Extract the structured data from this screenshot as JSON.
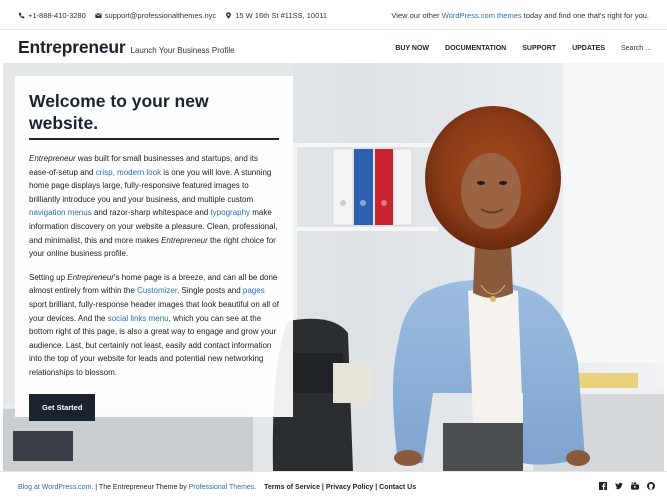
{
  "topbar": {
    "phone": "+1-888-410-3280",
    "email": "support@professionalthemes.nyc",
    "address": "15 W 16th St #11SS, 10011",
    "right_prefix": "View our other",
    "right_link": "WordPress.com themes",
    "right_suffix": "today and find one that's right for you."
  },
  "header": {
    "site_title": "Entrepreneur",
    "tagline": "Launch Your Business Profile",
    "nav": [
      "BUY NOW",
      "DOCUMENTATION",
      "SUPPORT",
      "UPDATES"
    ],
    "search_placeholder": "Search …"
  },
  "welcome": {
    "heading": "Welcome to your new website.",
    "p1": {
      "a": "Entrepreneur",
      "b": " was built for small businesses and startups, and its ease-of-setup and ",
      "link1": "crisp, modern look",
      "c": " is one you will love. A stunning home page displays large, fully-responsive featured images to brilliantly introduce you and your business, and multiple custom ",
      "link2": "navigation menus",
      "d": " and razor-sharp whitespace and ",
      "link3": "typography",
      "e": " make information discovery on your website a pleasure. Clean, professional, and minimalist, this and more makes ",
      "f": "Entrepreneur",
      "g": " the right choice for your online business profile."
    },
    "p2": {
      "a": "Setting up ",
      "b": "Entrepreneur",
      "c": "'s home page is a breeze, and can all be done almost entirely from within the ",
      "link1": "Customizer",
      "d": ". Single posts and ",
      "link2": "pages",
      "e": " sport brilliant, fully-response header images that look beautiful on all of your devices. And the ",
      "link3": "social links menu",
      "f": ", which you can see at the bottom right of this page, is also a great way to engage and grow your audience. Last, but certainly not least, easily add contact information into the top of your website for leads and potential new networking relationships to blossom."
    },
    "button": "Get Started"
  },
  "footer": {
    "blog_link": "Blog at WordPress.com.",
    "sep1": " | The Entrepreneur Theme by ",
    "theme_link": "Professional Themes.",
    "links": [
      "Terms of Service",
      "Privacy Policy",
      "Contact Us"
    ],
    "social": [
      "facebook-icon",
      "twitter-icon",
      "youtube-icon",
      "github-icon"
    ]
  },
  "colors": {
    "brand_dark": "#1b2331",
    "link_blue": "#2f6eb5",
    "jacket_blue": "#8fb2d8"
  }
}
